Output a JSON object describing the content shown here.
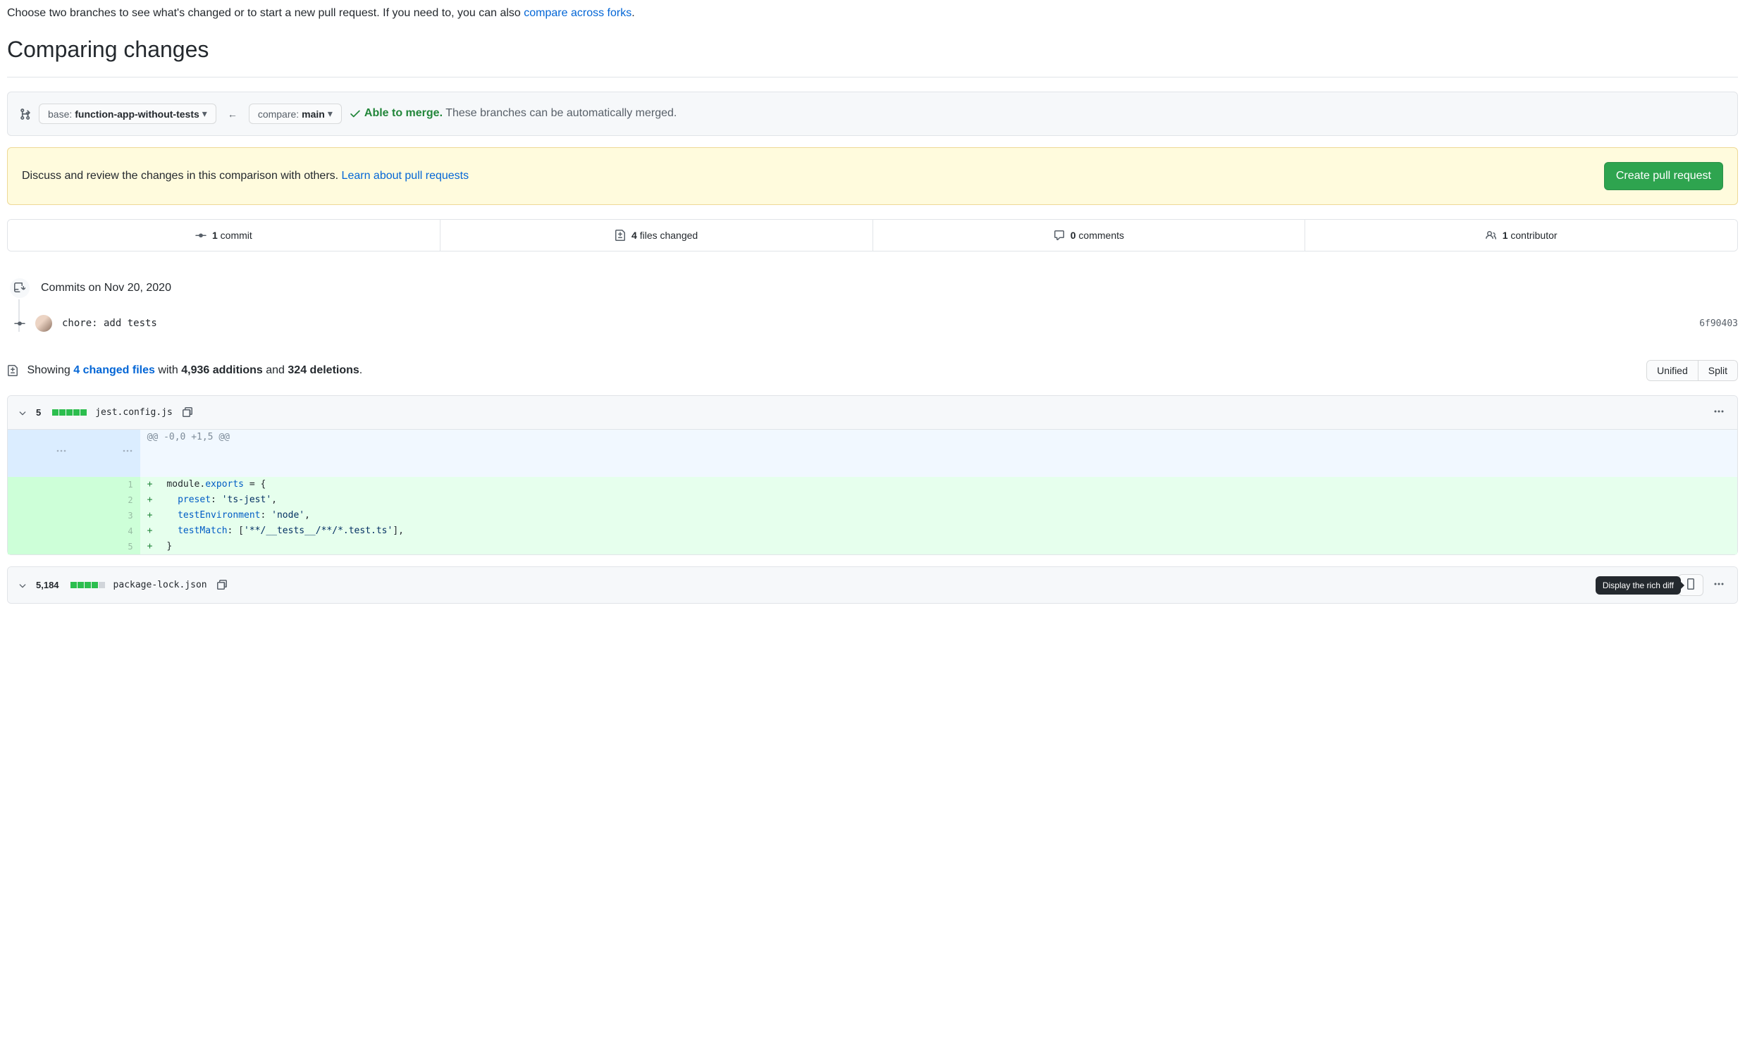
{
  "intro": {
    "prefix": "Choose two branches to see what's changed or to start a new pull request. If you need to, you can also ",
    "link": "compare across forks",
    "suffix": "."
  },
  "page_title": "Comparing changes",
  "branch": {
    "base_label": "base:",
    "base_value": "function-app-without-tests",
    "compare_label": "compare:",
    "compare_value": "main"
  },
  "merge": {
    "able": "Able to merge.",
    "detail": "These branches can be automatically merged."
  },
  "pr_prompt": {
    "text": "Discuss and review the changes in this comparison with others. ",
    "link": "Learn about pull requests",
    "button": "Create pull request"
  },
  "tabs": {
    "commits_bold": "1",
    "commits_text": "commit",
    "files_bold": "4",
    "files_text": "files changed",
    "comments_bold": "0",
    "comments_text": "comments",
    "contrib_bold": "1",
    "contrib_text": "contributor"
  },
  "timeline": {
    "date": "Commits on Nov 20, 2020",
    "commit_msg": "chore: add tests",
    "sha": "6f90403"
  },
  "diff_showing": {
    "prefix": "Showing ",
    "files_link": "4 changed files",
    "mid1": " with ",
    "additions": "4,936 additions",
    "mid2": " and ",
    "deletions": "324 deletions",
    "suffix": "."
  },
  "view_toggle": {
    "unified": "Unified",
    "split": "Split"
  },
  "file1": {
    "count": "5",
    "name": "jest.config.js",
    "hunk": "@@ -0,0 +1,5 @@",
    "lines": [
      {
        "n": "1",
        "html": "module.<span class='token-key'>exports</span> <span class='token-punct'>=</span> {"
      },
      {
        "n": "2",
        "html": "  <span class='token-key'>preset</span>: <span class='token-str'>'ts-jest'</span>,"
      },
      {
        "n": "3",
        "html": "  <span class='token-key'>testEnvironment</span>: <span class='token-str'>'node'</span>,"
      },
      {
        "n": "4",
        "html": "  <span class='token-key'>testMatch</span>: [<span class='token-str'>'**/__tests__/**/*.test.ts'</span>],"
      },
      {
        "n": "5",
        "html": "}"
      }
    ]
  },
  "file2": {
    "count": "5,184",
    "name": "package-lock.json",
    "tooltip": "Display the rich diff"
  }
}
